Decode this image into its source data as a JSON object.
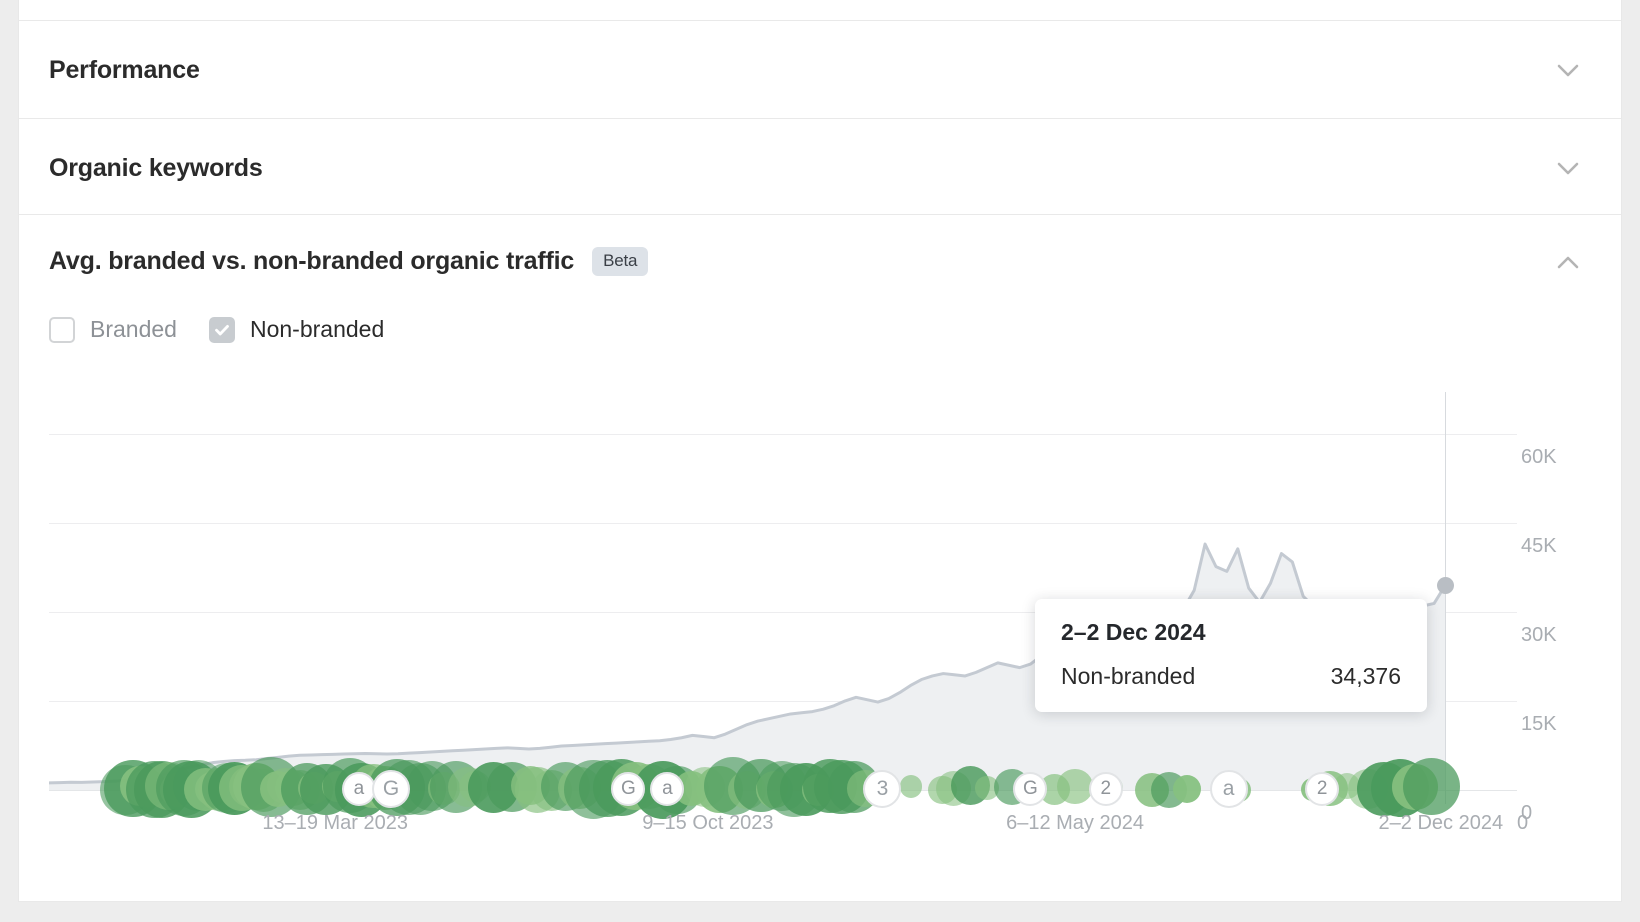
{
  "sections": [
    {
      "title": "Performance",
      "expanded": false,
      "chevron": "chevron-down-icon"
    },
    {
      "title": "Organic keywords",
      "expanded": false,
      "chevron": "chevron-down-icon"
    }
  ],
  "chart_section": {
    "title": "Avg. branded vs. non-branded organic traffic",
    "badge": "Beta",
    "expanded": true,
    "chevron": "chevron-up-icon",
    "legend": [
      {
        "label": "Branded",
        "checked": false
      },
      {
        "label": "Non-branded",
        "checked": true
      }
    ]
  },
  "tooltip": {
    "date": "2–2 Dec 2024",
    "series_name": "Non-branded",
    "value": "34,376"
  },
  "chart_data": {
    "type": "area",
    "title": "Avg. branded vs. non-branded organic traffic",
    "xlabel": "",
    "ylabel": "",
    "ylim": [
      0,
      67000
    ],
    "grid": true,
    "legend_position": "top-left",
    "ytick_labels": [
      "60K",
      "45K",
      "30K",
      "15K",
      "0"
    ],
    "ytick_values": [
      60000,
      45000,
      30000,
      15000,
      0
    ],
    "xtick_labels": [
      "13–19 Mar 2023",
      "9–15 Oct 2023",
      "6–12 May 2024",
      "2–2 Dec 2024"
    ],
    "series": [
      {
        "name": "Non-branded",
        "color": "#c4cad2",
        "fill": "#eef0f2",
        "values": [
          1200,
          1250,
          1300,
          1280,
          1350,
          1400,
          1500,
          1600,
          1800,
          2000,
          2400,
          2900,
          3400,
          3900,
          4300,
          4600,
          4800,
          4950,
          5000,
          5100,
          5300,
          5500,
          5700,
          5850,
          5900,
          5950,
          6000,
          6050,
          6100,
          6150,
          6100,
          6050,
          6100,
          6200,
          6300,
          6400,
          6500,
          6600,
          6700,
          6800,
          6900,
          7000,
          7100,
          7000,
          6900,
          7000,
          7200,
          7400,
          7500,
          7600,
          7700,
          7800,
          7900,
          8000,
          8100,
          8200,
          8300,
          8500,
          8800,
          9200,
          9000,
          8800,
          9400,
          10200,
          11000,
          11600,
          12000,
          12400,
          12800,
          13000,
          13200,
          13600,
          14200,
          15000,
          15600,
          15200,
          14800,
          15400,
          16400,
          17600,
          18600,
          19200,
          19600,
          19400,
          19200,
          19800,
          20600,
          21400,
          21000,
          20600,
          21200,
          22600,
          24400,
          26200,
          27400,
          28000,
          28400,
          28200,
          28000,
          28400,
          29000,
          29800,
          30200,
          29600,
          30400,
          33600,
          41400,
          37600,
          36800,
          40600,
          34000,
          31600,
          34800,
          39800,
          38400,
          32600,
          30800,
          31200,
          31600,
          31400,
          31000,
          30600,
          30800,
          31200,
          31000,
          30800,
          31000,
          31400,
          34376
        ]
      }
    ],
    "annotations": {
      "hover_point": {
        "x_label": "2–2 Dec 2024",
        "y_value": 34376,
        "series": "Non-branded"
      },
      "event_markers_description": "Google algorithm update bubbles along baseline",
      "marker_glyphs": [
        "a",
        "G",
        "G",
        "a",
        "3",
        "G",
        "2",
        "a",
        "2"
      ]
    }
  }
}
